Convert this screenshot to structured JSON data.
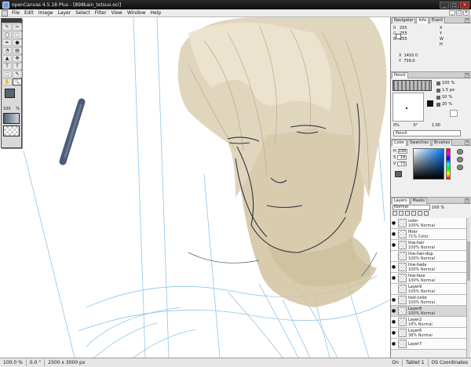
{
  "window": {
    "title": "openCanvas 4.5.18 Plus - [898kain_tetsuo.oci]",
    "min_label": "_",
    "max_label": "□",
    "close_label": "×"
  },
  "menu": {
    "items": [
      "File",
      "Edit",
      "Image",
      "Layer",
      "Select",
      "Filter",
      "View",
      "Window",
      "Help"
    ],
    "doc_buttons": [
      "_",
      "□",
      "×"
    ]
  },
  "toolbox": {
    "tools": [
      "✎",
      "✂",
      "◯",
      "⬚",
      "✒",
      "●",
      "◔",
      "▤",
      "▲",
      "✥",
      "T",
      "T",
      "⬚",
      "✎",
      "✋",
      "🔍"
    ],
    "zoom_value": "100",
    "zoom_unit": "%"
  },
  "navigator": {
    "tabs": [
      "Navigator",
      "Info",
      "Event"
    ],
    "active_tab": "Info",
    "rgb": [
      {
        "label": "R",
        "value": "255"
      },
      {
        "label": "G",
        "value": "255"
      },
      {
        "label": "B",
        "value": "255"
      }
    ],
    "right_labels": [
      "X",
      "Y",
      "W",
      "H"
    ],
    "x_label": "X",
    "x_value": "1410.0",
    "y_label": "Y",
    "y_value": "739.0"
  },
  "pencil": {
    "tab": "Pencil",
    "params": [
      {
        "value": "100",
        "unit": "%"
      },
      {
        "value": "1.5",
        "unit": "px"
      },
      {
        "value": "10",
        "unit": "%"
      },
      {
        "value": "20",
        "unit": "%"
      }
    ],
    "range_left": "0%",
    "range_mid": "0°",
    "range_right": "1.00",
    "name": "Pencil"
  },
  "color": {
    "tabs": [
      "Color",
      "Swatches",
      "Brushes"
    ],
    "active_tab": "Color",
    "h_label": "H",
    "h_value": "199",
    "s_label": "S",
    "s_value": "18",
    "v_label": "V",
    "v_value": "72",
    "current_color": "#556575"
  },
  "layers": {
    "tabs": [
      "Layers",
      "Masks"
    ],
    "active_tab": "Layers",
    "mode": "Normal",
    "opacity": "100",
    "opacity_unit": "%",
    "items": [
      {
        "name": "color",
        "sub": "100% Normal",
        "visible": true,
        "selected": false
      },
      {
        "name": "filter",
        "sub": "71% Color",
        "visible": true,
        "selected": false
      },
      {
        "name": "line-hair",
        "sub": "100% Normal",
        "visible": true,
        "selected": false
      },
      {
        "name": "line-hair-dup",
        "sub": "100% Normal",
        "visible": false,
        "selected": false
      },
      {
        "name": "line-hada",
        "sub": "100% Normal",
        "visible": true,
        "selected": false
      },
      {
        "name": "line-face",
        "sub": "100% Normal",
        "visible": true,
        "selected": false
      },
      {
        "name": "Layer9",
        "sub": "100% Normal",
        "visible": false,
        "selected": false
      },
      {
        "name": "text-color",
        "sub": "100% Normal",
        "visible": true,
        "selected": false
      },
      {
        "name": "Layer8",
        "sub": "100% Normal",
        "visible": true,
        "selected": true
      },
      {
        "name": "Layer2",
        "sub": "18% Normal",
        "visible": true,
        "selected": false
      },
      {
        "name": "Layer6",
        "sub": "38% Normal",
        "visible": true,
        "selected": false
      },
      {
        "name": "Layer7",
        "sub": "",
        "visible": true,
        "selected": false
      }
    ]
  },
  "status": {
    "zoom": "100.0 %",
    "angle": "0.0 °",
    "size": "2500 x 3000 px",
    "mode": "On",
    "tablet": "Tablet 1",
    "coords": "OS Coordinates"
  },
  "colors": {
    "accent_stroke": "#4a5c78",
    "sketch_blue": "#8fc6ea",
    "skin": "#d2c3a0",
    "hair": "#e0d6bd"
  }
}
